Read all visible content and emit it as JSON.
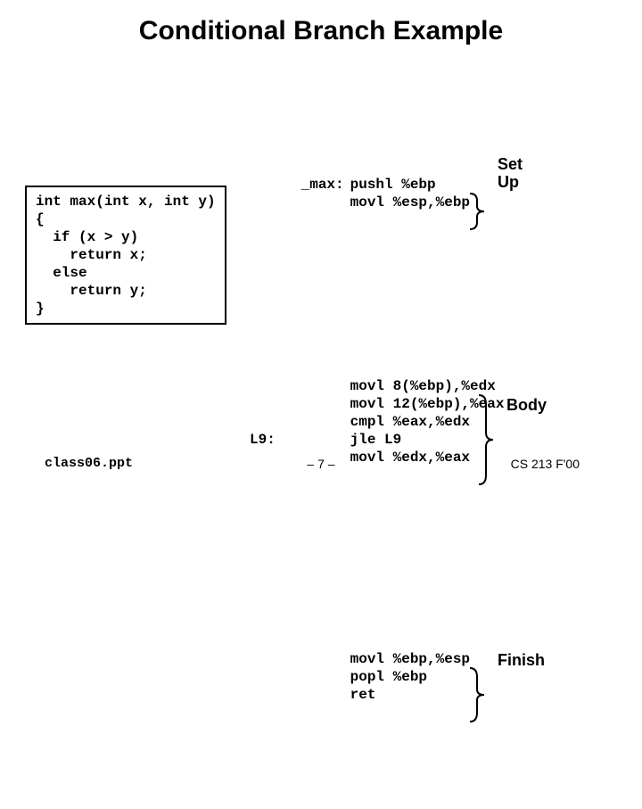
{
  "title": "Conditional Branch Example",
  "c_code": "int max(int x, int y)\n{\n  if (x > y)\n    return x;\n  else\n    return y;\n}",
  "asm": {
    "label_max": "_max:",
    "setup": "pushl %ebp\nmovl %esp,%ebp",
    "body": "movl 8(%ebp),%edx\nmovl 12(%ebp),%eax\ncmpl %eax,%edx\njle L9\nmovl %edx,%eax",
    "label_l9": "L9:",
    "finish": "movl %ebp,%esp\npopl %ebp\nret"
  },
  "annotations": {
    "setup": "Set\nUp",
    "body": "Body",
    "finish": "Finish"
  },
  "footer": {
    "left": "class06.ppt",
    "center": "– 7 –",
    "right": "CS 213 F'00"
  }
}
